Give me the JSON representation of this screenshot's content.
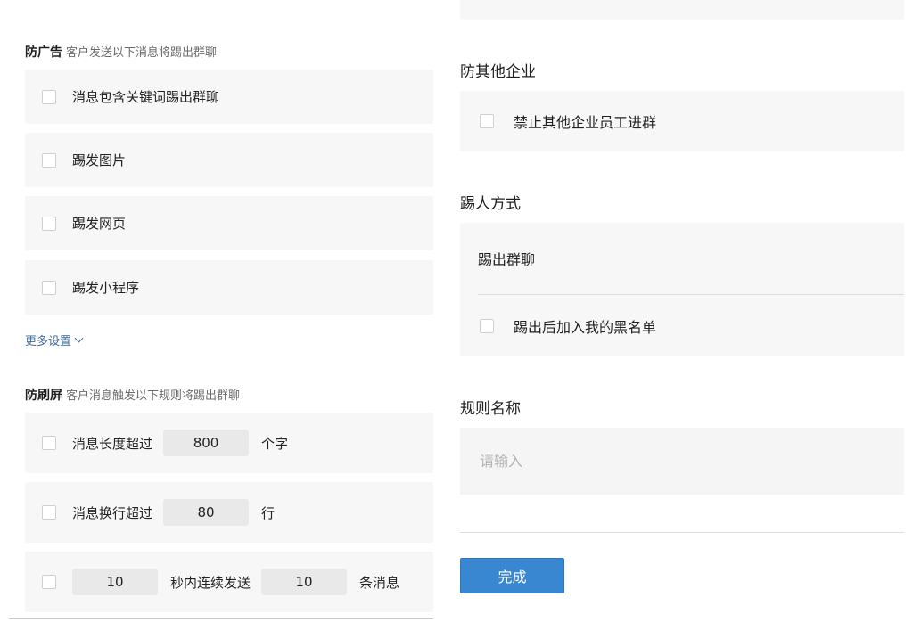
{
  "anti_ad": {
    "title": "防广告",
    "subtitle": "客户发送以下消息将踢出群聊",
    "items": [
      {
        "label": "消息包含关键词踢出群聊",
        "checked": false
      },
      {
        "label": "踢发图片",
        "checked": false
      },
      {
        "label": "踢发网页",
        "checked": false
      },
      {
        "label": "踢发小程序",
        "checked": false
      }
    ],
    "more_settings": "更多设置"
  },
  "anti_spam": {
    "title": "防刷屏",
    "subtitle": "客户消息触发以下规则将踢出群聊",
    "msg_length": {
      "label": "消息长度超过",
      "value": "800",
      "unit": "个字",
      "checked": false
    },
    "msg_lines": {
      "label": "消息换行超过",
      "value": "80",
      "unit": "行",
      "checked": false
    },
    "flood": {
      "seconds": "10",
      "mid": "秒内连续发送",
      "count": "10",
      "unit": "条消息",
      "checked": false
    }
  },
  "anti_other_corp": {
    "title": "防其他企业",
    "item": {
      "label": "禁止其他企业员工进群",
      "checked": false
    }
  },
  "kick_method": {
    "title": "踢人方式",
    "option": "踢出群聊",
    "blacklist": {
      "label": "踢出后加入我的黑名单",
      "checked": false
    }
  },
  "rule_name": {
    "title": "规则名称",
    "placeholder": "请输入",
    "value": ""
  },
  "submit_label": "完成",
  "colors": {
    "primary": "#3a87d1",
    "link": "#3e6c98",
    "row_bg": "#f7f7f7"
  }
}
